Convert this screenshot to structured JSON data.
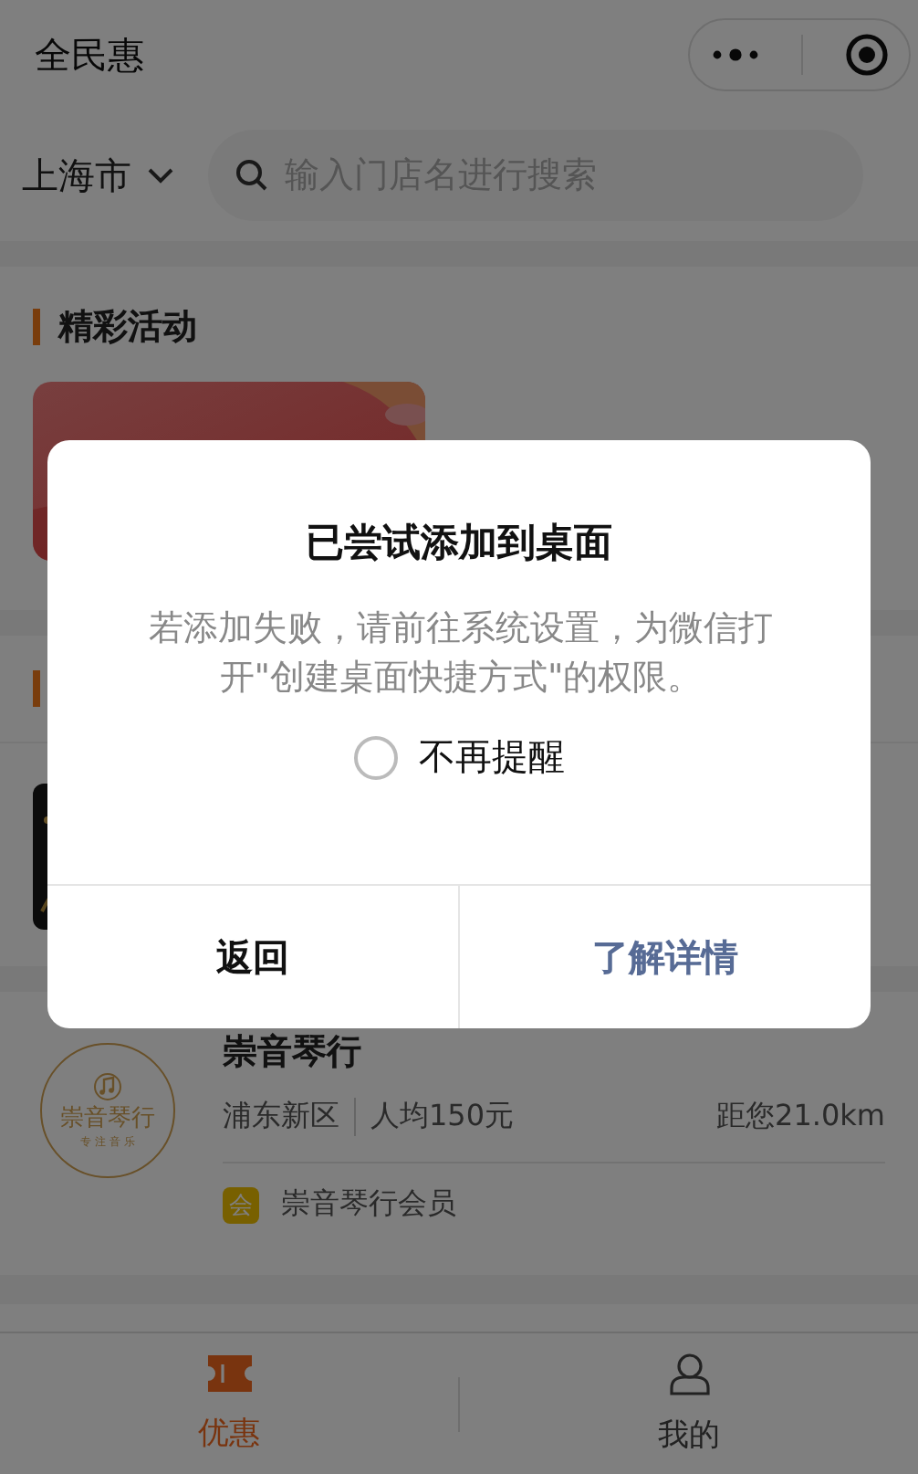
{
  "app_title": "全民惠",
  "city": "上海市",
  "search": {
    "placeholder": "输入门店名进行搜索"
  },
  "activity_section": {
    "title": "精彩活动"
  },
  "stores": [
    {
      "name": "崇音琴行",
      "logo": {
        "name": "崇音琴行",
        "slogan": "专 注 音 乐"
      },
      "district": "浦东新区",
      "avg_price": "人均150元",
      "distance": "距您21.0km",
      "member_badge": "会",
      "member_label": "崇音琴行会员"
    }
  ],
  "dialog": {
    "title": "已尝试添加到桌面",
    "message": "若添加失败，请前往系统设置，为微信打开\"创建桌面快捷方式\"的权限。",
    "checkbox": {
      "label": "不再提醒",
      "checked": false
    },
    "buttons": [
      {
        "label": "返回",
        "kind": "cancel"
      },
      {
        "label": "了解详情",
        "kind": "confirm"
      }
    ]
  },
  "tabbar": [
    {
      "label": "优惠",
      "selected": true,
      "kind": "ticket"
    },
    {
      "label": "我的",
      "selected": false,
      "kind": "person"
    }
  ]
}
